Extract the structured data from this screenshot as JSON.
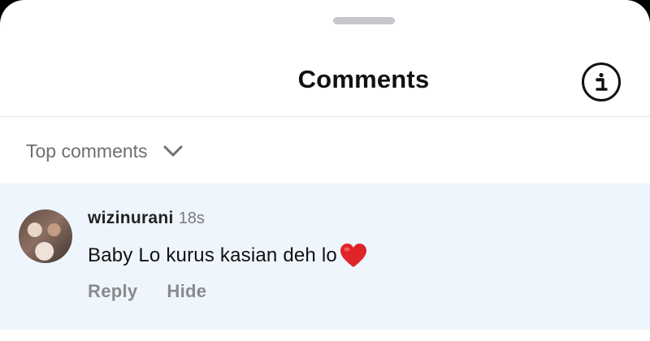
{
  "header": {
    "title": "Comments",
    "info_icon": "info-icon"
  },
  "sort": {
    "label": "Top comments",
    "icon": "chevron-down-icon"
  },
  "comments": [
    {
      "username": "wizinurani",
      "time": "18s",
      "text": "Baby Lo kurus kasian deh lo",
      "emoji": "red-heart-emoji",
      "actions": {
        "reply": "Reply",
        "hide": "Hide"
      }
    }
  ],
  "colors": {
    "comment_highlight": "#eef5fc",
    "muted_text": "#6e6e73",
    "heart": "#e0242a"
  }
}
